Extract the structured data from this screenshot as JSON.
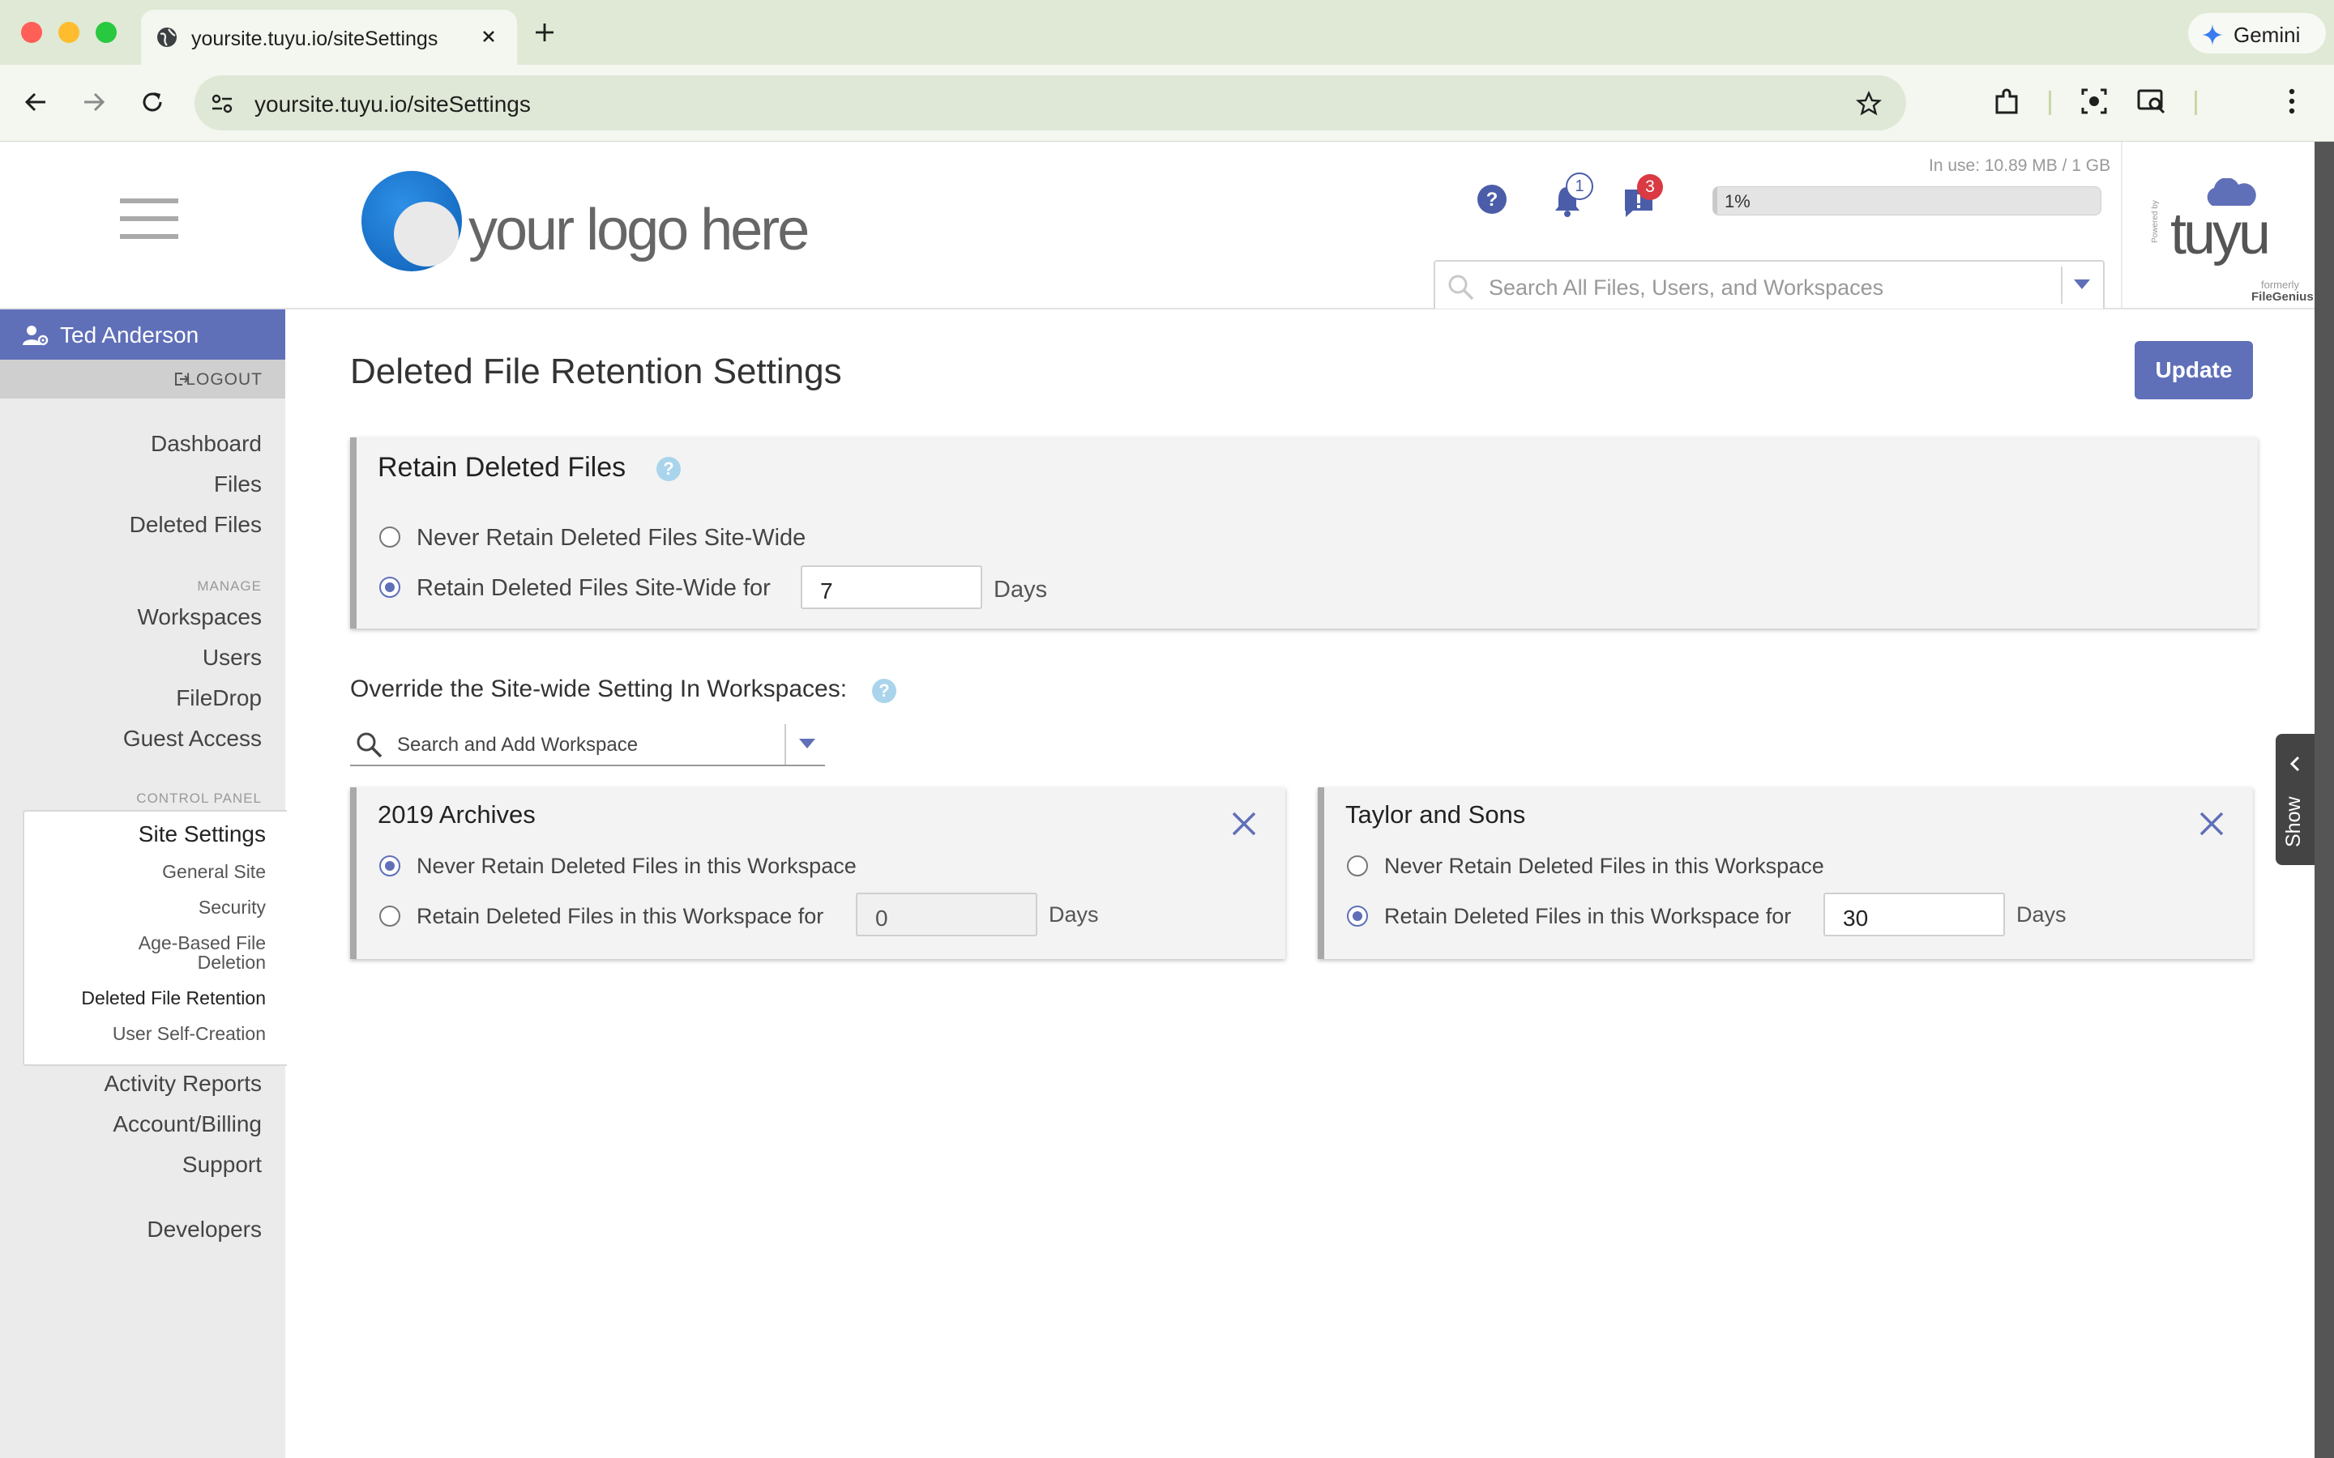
{
  "browser": {
    "tab_title": "yoursite.tuyu.io/siteSettings",
    "url": "yoursite.tuyu.io/siteSettings",
    "gemini_label": "Gemini"
  },
  "header": {
    "logo_text": "your logo here",
    "notification_count": "1",
    "message_count": "3",
    "usage_label": "In use: 10.89 MB / 1 GB",
    "usage_percent_label": "1%",
    "usage_fraction": 0.01,
    "search_placeholder": "Search All Files, Users, and Workspaces",
    "brand": {
      "powered_by": "Powered by",
      "name": "tuyu",
      "formerly": "formerly",
      "former_name": "FileGenius"
    }
  },
  "sidebar": {
    "user_name": "Ted Anderson",
    "logout_label": "LOGOUT",
    "top_links": [
      "Dashboard",
      "Files",
      "Deleted Files"
    ],
    "manage_caption": "MANAGE",
    "manage_links": [
      "Workspaces",
      "Users",
      "FileDrop",
      "Guest Access"
    ],
    "control_caption": "CONTROL PANEL",
    "site_settings_label": "Site Settings",
    "site_settings_sub": [
      "General Site",
      "Security",
      "Age-Based File Deletion",
      "Deleted File Retention",
      "User Self-Creation"
    ],
    "bottom_links": [
      "Activity Reports",
      "Account/Billing",
      "Support"
    ],
    "developers_label": "Developers"
  },
  "main": {
    "page_title": "Deleted File Retention Settings",
    "update_label": "Update",
    "retain": {
      "title": "Retain Deleted Files",
      "never_label": "Never Retain Deleted Files Site-Wide",
      "retain_label": "Retain Deleted Files Site-Wide for",
      "days_value": "7",
      "days_label": "Days",
      "selected": "retain"
    },
    "override_label": "Override the Site-wide Setting In Workspaces:",
    "workspace_search_placeholder": "Search and Add Workspace",
    "workspaces": [
      {
        "name": "2019 Archives",
        "never_label": "Never Retain Deleted Files in this Workspace",
        "retain_label": "Retain Deleted Files in this Workspace for",
        "days_value": "0",
        "days_label": "Days",
        "selected": "never"
      },
      {
        "name": "Taylor and Sons",
        "never_label": "Never Retain Deleted Files in this Workspace",
        "retain_label": "Retain Deleted Files in this Workspace for",
        "days_value": "30",
        "days_label": "Days",
        "selected": "retain"
      }
    ]
  },
  "right_panel": {
    "show_label": "Show"
  },
  "colors": {
    "accent": "#5f6fb8",
    "badge_red": "#d93a43",
    "help_blue": "#a9d4ec"
  }
}
